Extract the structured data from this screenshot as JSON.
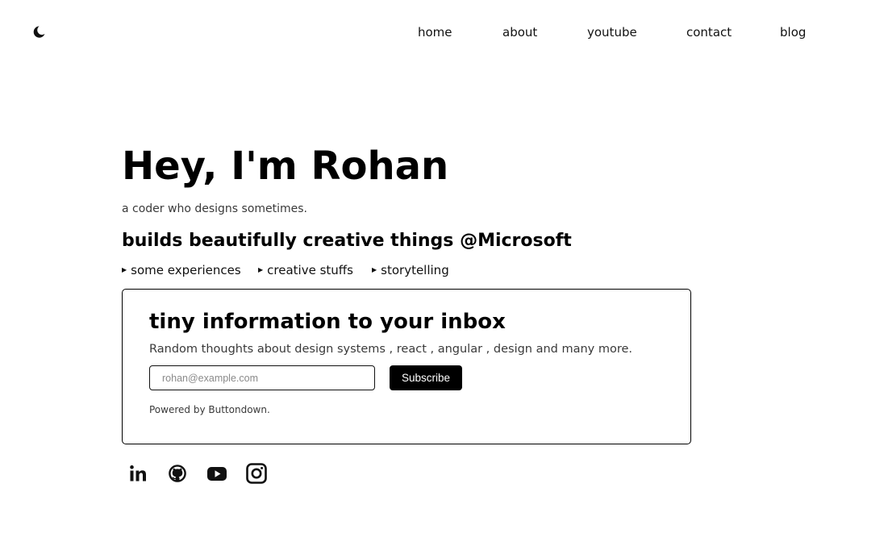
{
  "nav": {
    "items": [
      {
        "label": "home"
      },
      {
        "label": "about"
      },
      {
        "label": "youtube"
      },
      {
        "label": "contact"
      },
      {
        "label": "blog"
      }
    ]
  },
  "hero": {
    "title": "Hey, I'm Rohan",
    "tagline": "a coder who designs sometimes.",
    "headline": "builds beautifully creative things @Microsoft",
    "links": [
      {
        "label": "some experiences"
      },
      {
        "label": "creative stuffs"
      },
      {
        "label": "storytelling"
      }
    ]
  },
  "newsletter": {
    "title": "tiny information to your inbox",
    "description": "Random thoughts about design systems , react , angular , design and many more.",
    "email_placeholder": "rohan@example.com",
    "subscribe_label": "Subscribe",
    "powered_prefix": "Powered by ",
    "powered_link": "Buttondown."
  },
  "icons": {
    "theme": "moon-icon",
    "social": [
      "linkedin-icon",
      "github-icon",
      "youtube-icon",
      "instagram-icon"
    ]
  },
  "colors": {
    "text": "#000000",
    "muted": "#3a3a3a",
    "button_bg": "#000000",
    "button_text": "#ffffff",
    "background": "#ffffff"
  }
}
